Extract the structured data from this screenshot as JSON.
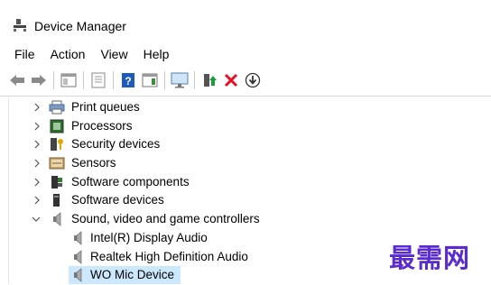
{
  "window": {
    "title": "Device Manager"
  },
  "menu": {
    "items": [
      "File",
      "Action",
      "View",
      "Help"
    ]
  },
  "toolbar": {
    "buttons": [
      "back-icon",
      "forward-icon",
      "properties-pane-icon",
      "show-hidden-icon",
      "help-icon",
      "action-pane-icon",
      "monitor-icon",
      "update-driver-icon",
      "uninstall-icon",
      "download-icon"
    ],
    "colors": {
      "uninstall": "#e81123",
      "update": "#1a9c3a",
      "help": "#1e5bbf"
    }
  },
  "tree": {
    "items": [
      {
        "label": "Print queues",
        "icon": "printer-icon",
        "level": 1,
        "state": "collapsed"
      },
      {
        "label": "Processors",
        "icon": "processor-icon",
        "level": 1,
        "state": "collapsed"
      },
      {
        "label": "Security devices",
        "icon": "security-device-icon",
        "level": 1,
        "state": "collapsed"
      },
      {
        "label": "Sensors",
        "icon": "sensor-icon",
        "level": 1,
        "state": "collapsed"
      },
      {
        "label": "Software components",
        "icon": "software-component-icon",
        "level": 1,
        "state": "collapsed"
      },
      {
        "label": "Software devices",
        "icon": "software-device-icon",
        "level": 1,
        "state": "collapsed"
      },
      {
        "label": "Sound, video and game controllers",
        "icon": "speaker-icon",
        "level": 1,
        "state": "expanded"
      },
      {
        "label": "Intel(R) Display Audio",
        "icon": "speaker-icon",
        "level": 2
      },
      {
        "label": "Realtek High Definition Audio",
        "icon": "speaker-icon",
        "level": 2
      },
      {
        "label": "WO Mic Device",
        "icon": "speaker-icon",
        "level": 2,
        "selected": true
      }
    ]
  },
  "watermark": {
    "text": "最需网",
    "color": "#5a2ccf"
  }
}
